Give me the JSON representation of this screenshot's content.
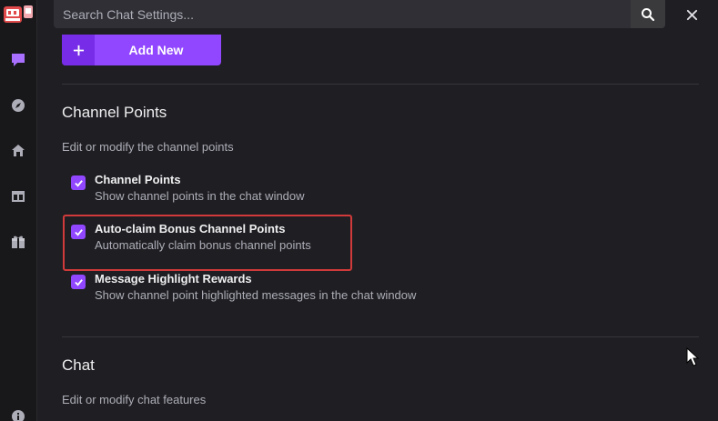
{
  "search": {
    "placeholder": "Search Chat Settings..."
  },
  "rail": {
    "icons": [
      "chat-bubble-icon",
      "compass-icon",
      "home-icon",
      "layout-icon",
      "gift-icon",
      "info-icon"
    ]
  },
  "buttons": {
    "add_new": "Add New"
  },
  "sections": {
    "channel_points": {
      "title": "Channel Points",
      "description": "Edit or modify the channel points",
      "options": [
        {
          "title": "Channel Points",
          "subtitle": "Show channel points in the chat window",
          "checked": true
        },
        {
          "title": "Auto-claim Bonus Channel Points",
          "subtitle": "Automatically claim bonus channel points",
          "checked": true
        },
        {
          "title": "Message Highlight Rewards",
          "subtitle": "Show channel point highlighted messages in the chat window",
          "checked": true
        }
      ]
    },
    "chat": {
      "title": "Chat",
      "description": "Edit or modify chat features"
    }
  },
  "colors": {
    "accent": "#9147ff",
    "highlight": "#d13a3a",
    "background": "#1f1f23"
  }
}
